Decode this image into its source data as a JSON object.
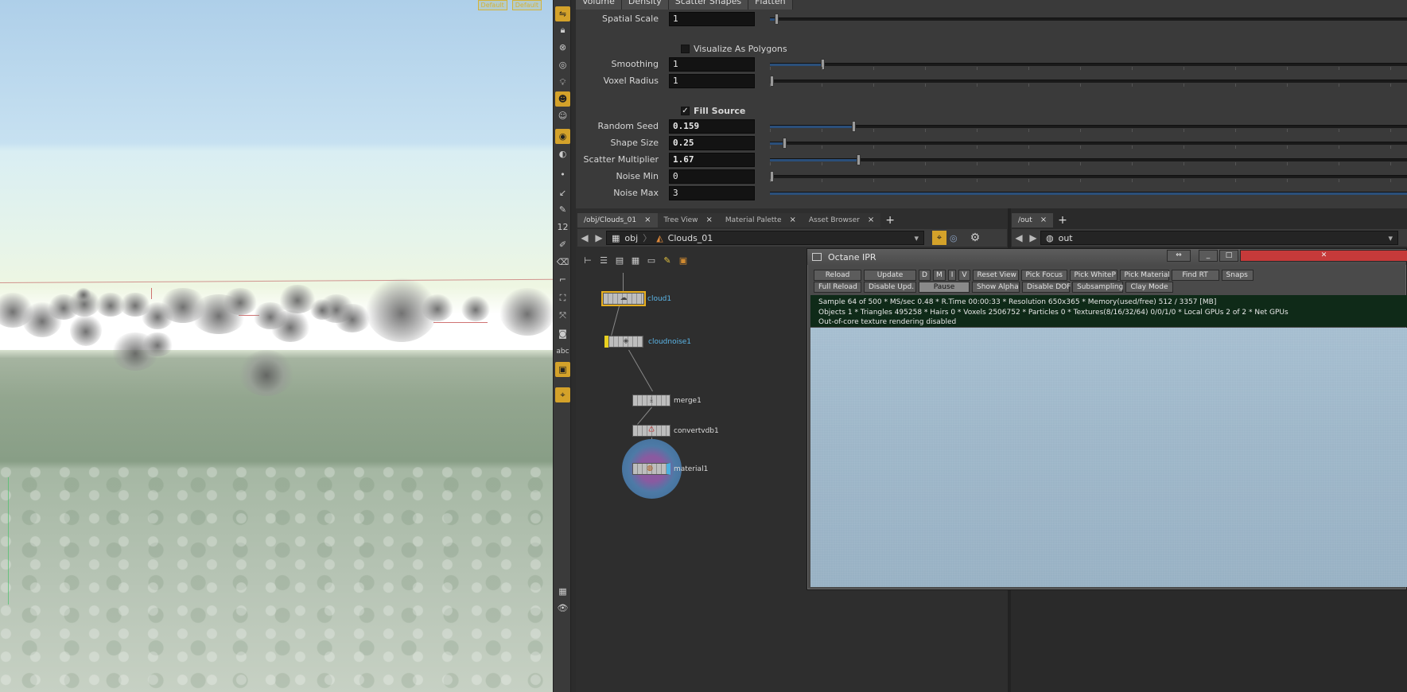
{
  "viewport": {
    "tags": [
      "Default",
      "Default"
    ],
    "clouds": 25
  },
  "toolbar": {
    "label_tool": "abc",
    "number_tool": "12"
  },
  "params": {
    "tabs": [
      "Volume",
      "Density",
      "Scatter Shapes",
      "Flatten"
    ],
    "rows": {
      "spatial_scale": {
        "label": "Spatial Scale",
        "value": "1"
      },
      "visualize_as_polygons": {
        "label": "Visualize As Polygons",
        "checked": false
      },
      "smoothing": {
        "label": "Smoothing",
        "value": "1"
      },
      "voxel_radius": {
        "label": "Voxel Radius",
        "value": "1"
      },
      "fill_source": {
        "label": "Fill Source",
        "checked": true
      },
      "random_seed": {
        "label": "Random Seed",
        "value": "0.159"
      },
      "shape_size": {
        "label": "Shape Size",
        "value": "0.25"
      },
      "scatter_multiplier": {
        "label": "Scatter Multiplier",
        "value": "1.67"
      },
      "noise_min": {
        "label": "Noise Min",
        "value": "0"
      },
      "noise_max": {
        "label": "Noise Max",
        "value": "3"
      }
    }
  },
  "network": {
    "tabs": [
      "/obj/Clouds_01",
      "Tree View",
      "Material Palette",
      "Asset Browser"
    ],
    "path": [
      "obj",
      "Clouds_01"
    ],
    "nodes": [
      "cloud1",
      "cloudnoise1",
      "merge1",
      "convertvdb1",
      "material1"
    ]
  },
  "outpane": {
    "tab": "/out",
    "path": "out"
  },
  "ipr": {
    "title": "Octane IPR",
    "row1": [
      "Reload",
      "Update",
      "D",
      "M",
      "I",
      "V",
      "Reset View",
      "Pick Focus",
      "Pick WhiteP",
      "Pick Material",
      "Find RT",
      "Snaps"
    ],
    "row2": [
      "Full Reload",
      "Disable Upd.",
      "Pause",
      "Show Alpha",
      "Disable DOF",
      "Subsampling",
      "Clay Mode"
    ],
    "status": [
      "Sample 64 of 500 * MS/sec 0.48 * R.Time 00:00:33 * Resolution 650x365 * Memory(used/free) 512 / 3357 [MB]",
      "Objects 1 * Triangles 495258 * Hairs 0 * Voxels 2506752 * Particles 0 * Textures(8/16/32/64) 0/0/1/0 * Local GPUs 2 of 2 * Net GPUs",
      "Out-of-core texture rendering disabled"
    ]
  },
  "colors": {
    "accent": "#d4a22a",
    "node_label": "#5bb6e8",
    "status_bg": "#0f2a18"
  }
}
